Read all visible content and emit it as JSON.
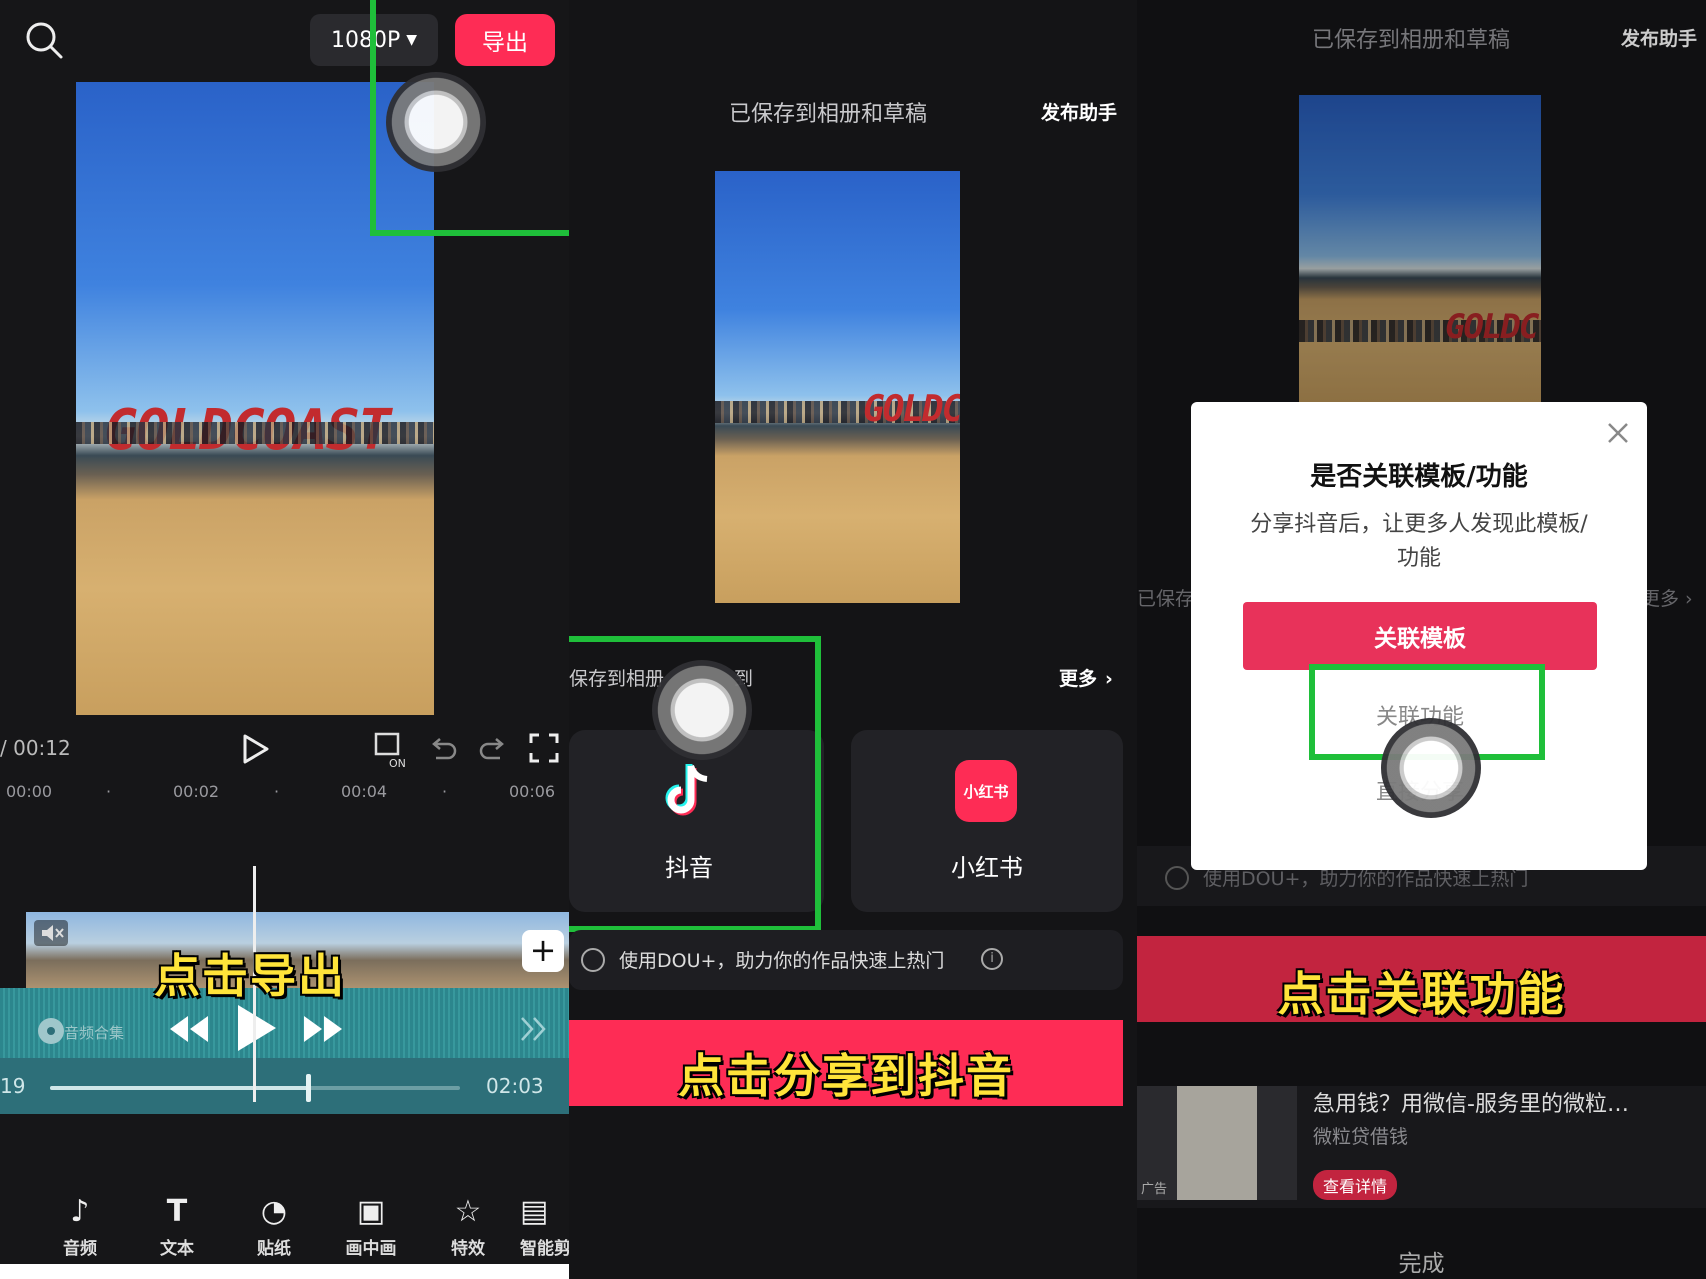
{
  "panel1": {
    "resolution": "1080P",
    "export_label": "导出",
    "time_total": "/ 00:12",
    "ruler": [
      "00:00",
      "00:02",
      "00:04",
      "00:06"
    ],
    "sign_text": "GOLDCOAST",
    "caption": "点击导出",
    "music_label": "音频合集",
    "time_left": "19",
    "time_right": "02:03",
    "music_progress": 0.63,
    "tools": [
      {
        "icon": "music-note-icon",
        "label": "音频"
      },
      {
        "icon": "text-icon",
        "label": "文本"
      },
      {
        "icon": "sticker-icon",
        "label": "贴纸"
      },
      {
        "icon": "pip-icon",
        "label": "画中画"
      },
      {
        "icon": "effects-icon",
        "label": "特效"
      },
      {
        "icon": "smart-cut-icon",
        "label": "智能剪"
      }
    ]
  },
  "panel2": {
    "saved_title": "已保存到相册和草稿",
    "publish_helper": "发布助手",
    "share_title": "保存到相册",
    "share_title_tail": "到",
    "more_label": "更多",
    "apps": [
      {
        "name": "抖音",
        "icon": "douyin-icon"
      },
      {
        "name": "小红书",
        "icon": "xiaohongshu-icon",
        "icon_text": "小红书"
      }
    ],
    "dou_plus": "使用DOU+，助力你的作品快速上热门",
    "caption": "点击分享到抖音",
    "sign_text": "GOLDC",
    "accent": "#fe2c55"
  },
  "panel3": {
    "saved_title": "已保存到相册和草稿",
    "publish_helper": "发布助手",
    "side_left": "已保存",
    "side_right": "更多",
    "dialog": {
      "title": "是否关联模板/功能",
      "desc": "分享抖音后，让更多人发现此模板/功能",
      "primary": "关联模板",
      "secondary": "关联功能",
      "tertiary": "直接分享"
    },
    "dou_plus": "使用DOU+，助力你的作品快速上热门",
    "caption": "点击关联功能",
    "ad": {
      "tag": "广告",
      "title": "急用钱？用微信-服务里的微粒…",
      "subtitle": "微粒贷借钱",
      "button": "查看详情"
    },
    "done": "完成",
    "sign_text": "GOLDC"
  }
}
